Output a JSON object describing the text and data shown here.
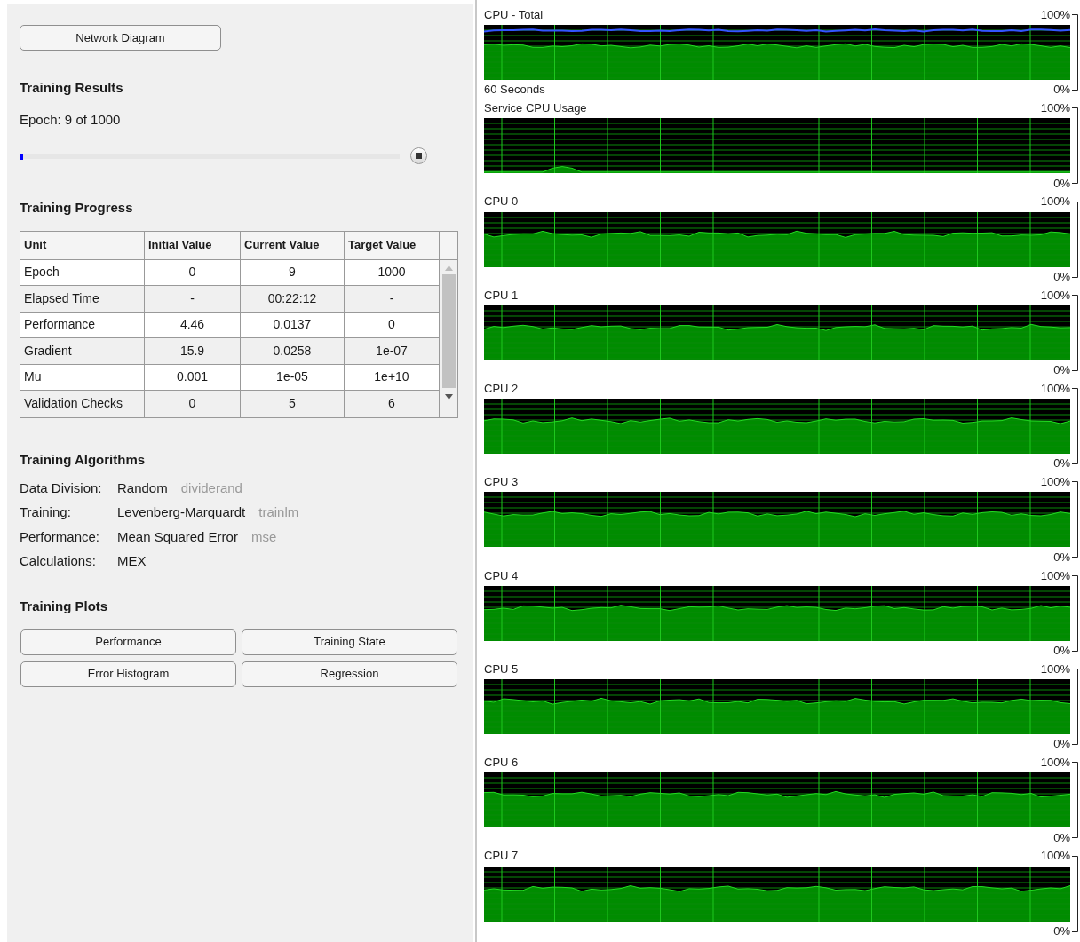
{
  "network_diagram_button": "Network Diagram",
  "training_results": {
    "heading": "Training Results",
    "epoch_text": "Epoch: 9 of 1000",
    "progress": {
      "level": 0.009
    }
  },
  "training_progress": {
    "heading": "Training Progress",
    "table": {
      "columns": [
        "Unit",
        "Initial Value",
        "Current Value",
        "Target Value"
      ],
      "rows": [
        [
          "Epoch",
          "0",
          "9",
          "1000"
        ],
        [
          "Elapsed Time",
          "-",
          "00:22:12",
          "-"
        ],
        [
          "Performance",
          "4.46",
          "0.0137",
          "0"
        ],
        [
          "Gradient",
          "15.9",
          "0.0258",
          "1e-07"
        ],
        [
          "Mu",
          "0.001",
          "1e-05",
          "1e+10"
        ],
        [
          "Validation Checks",
          "0",
          "5",
          "6"
        ]
      ]
    }
  },
  "training_algorithms": {
    "heading": "Training Algorithms",
    "rows": [
      {
        "label": "Data Division:",
        "value": "Random",
        "function": "dividerand"
      },
      {
        "label": "Training:",
        "value": "Levenberg-Marquardt",
        "function": "trainlm"
      },
      {
        "label": "Performance:",
        "value": "Mean Squared Error",
        "function": "mse"
      },
      {
        "label": "Calculations:",
        "value": "MEX"
      }
    ]
  },
  "training_plots": {
    "heading": "Training Plots",
    "buttons": [
      "Performance",
      "Training State",
      "Error Histogram",
      "Regression"
    ]
  },
  "cpu_graphs": [
    {
      "kind": "total",
      "title": "CPU - Total",
      "top_label": "100%",
      "bottom_label": "0%",
      "footer": "60 Seconds"
    },
    {
      "kind": "service",
      "title": "Service CPU Usage",
      "top_label": "100%",
      "bottom_label": "0%"
    },
    {
      "kind": "core",
      "title": "CPU 0",
      "top_label": "100%",
      "bottom_label": "0%"
    },
    {
      "kind": "core",
      "title": "CPU 1",
      "top_label": "100%",
      "bottom_label": "0%"
    },
    {
      "kind": "core",
      "title": "CPU 2",
      "top_label": "100%",
      "bottom_label": "0%"
    },
    {
      "kind": "core",
      "title": "CPU 3",
      "top_label": "100%",
      "bottom_label": "0%"
    },
    {
      "kind": "core",
      "title": "CPU 4",
      "top_label": "100%",
      "bottom_label": "0%"
    },
    {
      "kind": "core",
      "title": "CPU 5",
      "top_label": "100%",
      "bottom_label": "0%"
    },
    {
      "kind": "core",
      "title": "CPU 6",
      "top_label": "100%",
      "bottom_label": "0%"
    },
    {
      "kind": "core",
      "title": "CPU 7",
      "top_label": "100%",
      "bottom_label": "0%"
    }
  ]
}
